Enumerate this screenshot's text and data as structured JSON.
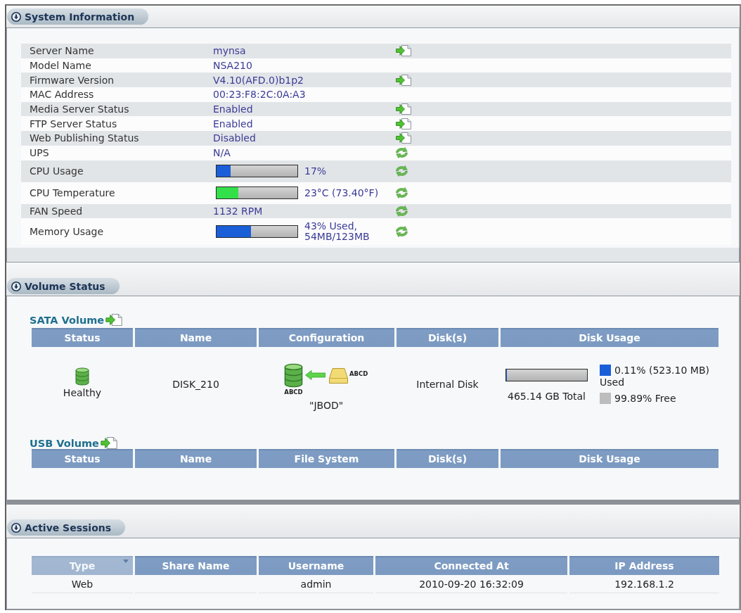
{
  "system_information": {
    "title": "System Information",
    "rows": [
      {
        "kind": "text",
        "label": "Server Name",
        "value": "mynsa",
        "action": {
          "kind": "go"
        }
      },
      {
        "kind": "text",
        "label": "Model Name",
        "value": "NSA210"
      },
      {
        "kind": "text",
        "label": "Firmware Version",
        "value": "V4.10(AFD.0)b1p2",
        "action": {
          "kind": "go"
        }
      },
      {
        "kind": "text",
        "label": "MAC Address",
        "value": "00:23:F8:2C:0A:A3"
      },
      {
        "kind": "text",
        "label": "Media Server Status",
        "value": "Enabled",
        "action": {
          "kind": "go"
        }
      },
      {
        "kind": "text",
        "label": "FTP Server Status",
        "value": "Enabled",
        "action": {
          "kind": "go"
        }
      },
      {
        "kind": "text",
        "label": "Web Publishing Status",
        "value": "Disabled",
        "action": {
          "kind": "go"
        }
      },
      {
        "kind": "text",
        "label": "UPS",
        "value": "N/A",
        "action": {
          "kind": "refresh"
        }
      },
      {
        "kind": "meter",
        "label": "CPU Usage",
        "level": 0.17,
        "color": "#1a5fd8",
        "value": "17%",
        "action": {
          "kind": "refresh"
        }
      },
      {
        "kind": "meter",
        "label": "CPU Temperature",
        "level": 0.27,
        "color": "#33e04a",
        "value": "23°C (73.40°F)",
        "action": {
          "kind": "refresh"
        }
      },
      {
        "kind": "text",
        "label": "FAN Speed",
        "value": "1132 RPM",
        "action": {
          "kind": "refresh"
        }
      },
      {
        "kind": "meter",
        "label": "Memory Usage",
        "level": 0.43,
        "color": "#1a5fd8",
        "value": "43% Used, 54MB/123MB",
        "action": {
          "kind": "refresh"
        }
      }
    ]
  },
  "volume_status": {
    "title": "Volume Status",
    "sata_volume": {
      "title": "SATA Volume",
      "columns": [
        "Status",
        "Name",
        "Configuration",
        "Disk(s)",
        "Disk Usage"
      ],
      "rows": [
        {
          "status": "Healthy",
          "name": "DISK_210",
          "configuration": {
            "member_label": "ABCD",
            "disk_label": "ABCD",
            "type": "\"JBOD\""
          },
          "disks": "Internal Disk",
          "usage": {
            "level": 0.0011,
            "total": "465.14 GB Total",
            "legend": [
              {
                "label": "0.11% (523.10 MB) Used",
                "color": "#1a5fd8"
              },
              {
                "label": "99.89% Free",
                "color": "#bdbdbd"
              }
            ]
          }
        }
      ]
    },
    "usb_volume": {
      "title": "USB Volume",
      "columns": [
        "Status",
        "Name",
        "File System",
        "Disk(s)",
        "Disk Usage"
      ]
    }
  },
  "active_sessions": {
    "title": "Active Sessions",
    "columns": [
      {
        "label": "Type",
        "sorted": true
      },
      {
        "label": "Share Name",
        "sorted": false
      },
      {
        "label": "Username",
        "sorted": false
      },
      {
        "label": "Connected At",
        "sorted": false
      },
      {
        "label": "IP Address",
        "sorted": false
      }
    ],
    "rows": [
      {
        "type": "Web",
        "username": "admin",
        "connected_at": "2010-09-20 16:32:09",
        "ip_address": "192.168.1.2"
      }
    ]
  }
}
